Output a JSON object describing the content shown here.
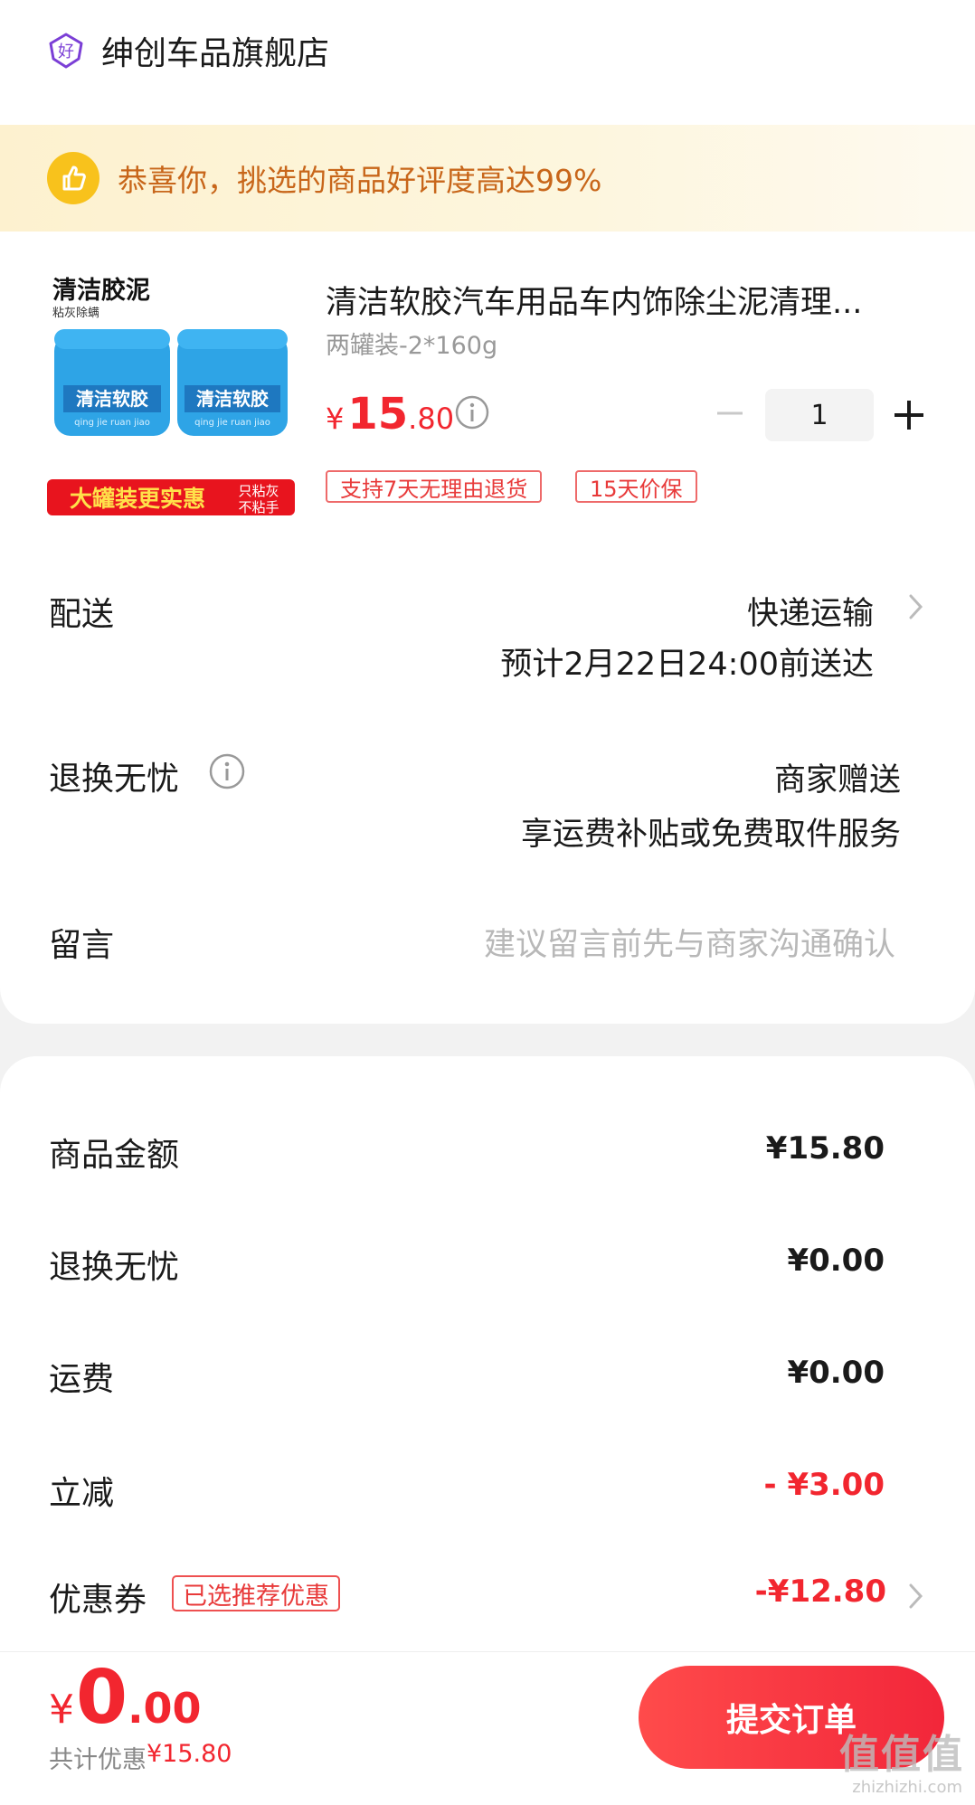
{
  "store": {
    "name": "绅创车品旗舰店",
    "icon": "store-good-badge-icon"
  },
  "banner": {
    "text": "恭喜你，挑选的商品好评度高达99%",
    "icon": "thumbs-up-icon"
  },
  "product": {
    "title": "清洁软胶汽车用品车内饰除尘泥清理...",
    "spec": "两罐装-2*160g",
    "price_symbol": "¥",
    "price_int": "15",
    "price_dec": ".80",
    "quantity": "1",
    "tags": [
      "支持7天无理由退货",
      "15天价保"
    ],
    "image": {
      "headline": "清洁胶泥",
      "subhead": "粘灰除螨",
      "jar_label": "清洁软胶",
      "jar_pinyin": "qing jie ruan jiao",
      "promo": "大罐装更实惠",
      "promo_side": [
        "只粘灰",
        "不粘手"
      ]
    }
  },
  "delivery": {
    "label": "配送",
    "method": "快递运输",
    "eta": "预计2月22日24:00前送达"
  },
  "return_service": {
    "label": "退换无忧",
    "line1": "商家赠送",
    "line2": "享运费补贴或免费取件服务"
  },
  "message": {
    "label": "留言",
    "placeholder": "建议留言前先与商家沟通确认"
  },
  "summary": {
    "goods_amount": {
      "label": "商品金额",
      "value": "¥15.80"
    },
    "return_fee": {
      "label": "退换无忧",
      "value": "¥0.00"
    },
    "shipping": {
      "label": "运费",
      "value": "¥0.00"
    },
    "instant_discount": {
      "label": "立减",
      "value": "- ¥3.00"
    },
    "coupon": {
      "label": "优惠券",
      "badge": "已选推荐优惠",
      "value": "-¥12.80"
    }
  },
  "footer": {
    "total_symbol": "¥",
    "total_int": "0",
    "total_dec": ".00",
    "discount_label": "共计优惠",
    "discount_value": "¥15.80",
    "submit_label": "提交订单"
  },
  "watermark": {
    "text": "值值值",
    "sub": "zhizhizhi.com"
  },
  "colors": {
    "accent": "#f2262f",
    "banner_text": "#c8661a",
    "banner_bg": "#fdf1cf",
    "thumb": "#f8c21c"
  }
}
